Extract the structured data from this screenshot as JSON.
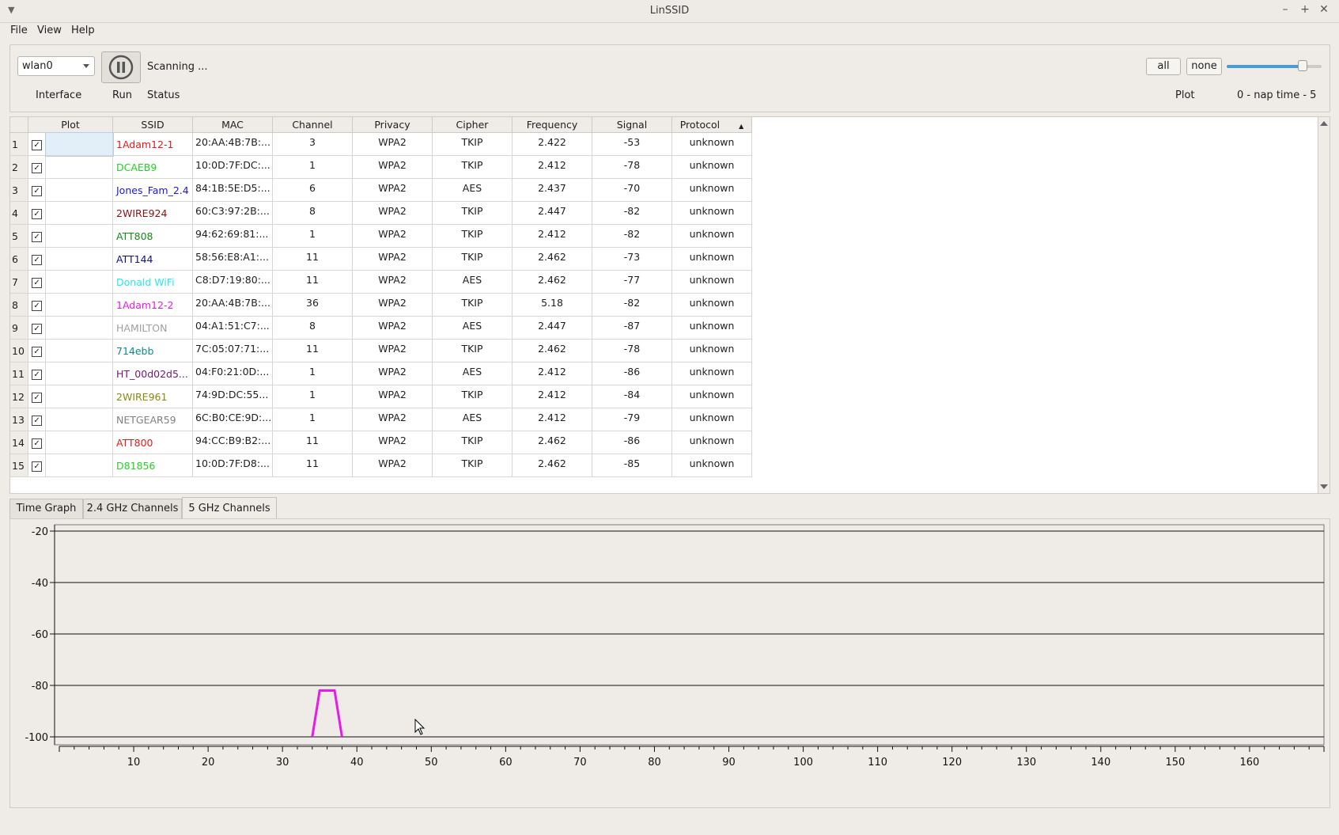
{
  "window": {
    "title": "LinSSID"
  },
  "menu": {
    "file": "File",
    "view": "View",
    "help": "Help"
  },
  "toolbar": {
    "interface_value": "wlan0",
    "status_text": "Scanning ...",
    "label_interface": "Interface",
    "label_run": "Run",
    "label_status": "Status",
    "btn_all": "all",
    "btn_none": "none",
    "label_plot": "Plot",
    "label_naptime": "0 - nap time - 5",
    "nap_time_level": 0.8
  },
  "table": {
    "headers": [
      "Plot",
      "SSID",
      "MAC",
      "Channel",
      "Privacy",
      "Cipher",
      "Frequency",
      "Signal",
      "Protocol"
    ],
    "rows": [
      {
        "n": "1",
        "ssid": "1Adam12-1",
        "color": "#e51a1a",
        "mac": "20:AA:4B:7B:...",
        "channel": "3",
        "privacy": "WPA2",
        "cipher": "TKIP",
        "freq": "2.422",
        "signal": "-53",
        "protocol": "unknown"
      },
      {
        "n": "2",
        "ssid": "DCAEB9",
        "color": "#22d322",
        "mac": "10:0D:7F:DC:...",
        "channel": "1",
        "privacy": "WPA2",
        "cipher": "TKIP",
        "freq": "2.412",
        "signal": "-78",
        "protocol": "unknown"
      },
      {
        "n": "3",
        "ssid": "Jones_Fam_2.4",
        "color": "#1a1adc",
        "mac": "84:1B:5E:D5:...",
        "channel": "6",
        "privacy": "WPA2",
        "cipher": "AES",
        "freq": "2.437",
        "signal": "-70",
        "protocol": "unknown"
      },
      {
        "n": "4",
        "ssid": "2WIRE924",
        "color": "#8b1010",
        "mac": "60:C3:97:2B:...",
        "channel": "8",
        "privacy": "WPA2",
        "cipher": "TKIP",
        "freq": "2.447",
        "signal": "-82",
        "protocol": "unknown"
      },
      {
        "n": "5",
        "ssid": "ATT808",
        "color": "#158c15",
        "mac": "94:62:69:81:...",
        "channel": "1",
        "privacy": "WPA2",
        "cipher": "TKIP",
        "freq": "2.412",
        "signal": "-82",
        "protocol": "unknown"
      },
      {
        "n": "6",
        "ssid": "ATT144",
        "color": "#12127a",
        "mac": "58:56:E8:A1:...",
        "channel": "11",
        "privacy": "WPA2",
        "cipher": "TKIP",
        "freq": "2.462",
        "signal": "-73",
        "protocol": "unknown"
      },
      {
        "n": "7",
        "ssid": "Donald WiFi",
        "color": "#28e8e8",
        "mac": "C8:D7:19:80:...",
        "channel": "11",
        "privacy": "WPA2",
        "cipher": "AES",
        "freq": "2.462",
        "signal": "-77",
        "protocol": "unknown"
      },
      {
        "n": "8",
        "ssid": "1Adam12-2",
        "color": "#e81ae8",
        "mac": "20:AA:4B:7B:...",
        "channel": "36",
        "privacy": "WPA2",
        "cipher": "TKIP",
        "freq": "5.18",
        "signal": "-82",
        "protocol": "unknown"
      },
      {
        "n": "9",
        "ssid": "HAMILTON",
        "color": "#a0a0a0",
        "mac": "04:A1:51:C7:...",
        "channel": "8",
        "privacy": "WPA2",
        "cipher": "AES",
        "freq": "2.447",
        "signal": "-87",
        "protocol": "unknown"
      },
      {
        "n": "10",
        "ssid": "714ebb",
        "color": "#0f8a8a",
        "mac": "7C:05:07:71:...",
        "channel": "11",
        "privacy": "WPA2",
        "cipher": "TKIP",
        "freq": "2.462",
        "signal": "-78",
        "protocol": "unknown"
      },
      {
        "n": "11",
        "ssid": "HT_00d02d5...",
        "color": "#7a127a",
        "mac": "04:F0:21:0D:...",
        "channel": "1",
        "privacy": "WPA2",
        "cipher": "AES",
        "freq": "2.412",
        "signal": "-86",
        "protocol": "unknown"
      },
      {
        "n": "12",
        "ssid": "2WIRE961",
        "color": "#8a8a10",
        "mac": "74:9D:DC:55...",
        "channel": "1",
        "privacy": "WPA2",
        "cipher": "TKIP",
        "freq": "2.412",
        "signal": "-84",
        "protocol": "unknown"
      },
      {
        "n": "13",
        "ssid": "NETGEAR59",
        "color": "#808080",
        "mac": "6C:B0:CE:9D:...",
        "channel": "1",
        "privacy": "WPA2",
        "cipher": "AES",
        "freq": "2.412",
        "signal": "-79",
        "protocol": "unknown"
      },
      {
        "n": "14",
        "ssid": "ATT800",
        "color": "#e51a1a",
        "mac": "94:CC:B9:B2:...",
        "channel": "11",
        "privacy": "WPA2",
        "cipher": "TKIP",
        "freq": "2.462",
        "signal": "-86",
        "protocol": "unknown"
      },
      {
        "n": "15",
        "ssid": "D81856",
        "color": "#22d322",
        "mac": "10:0D:7F:D8:...",
        "channel": "11",
        "privacy": "WPA2",
        "cipher": "TKIP",
        "freq": "2.462",
        "signal": "-85",
        "protocol": "unknown"
      }
    ]
  },
  "tabs": [
    "Time Graph",
    "2.4 GHz Channels",
    "5 GHz Channels"
  ],
  "active_tab": "5 GHz Channels",
  "chart_data": {
    "type": "line",
    "ylim": [
      -100,
      -20
    ],
    "yticks": [
      -20,
      -40,
      -60,
      -80,
      -100
    ],
    "xlim": [
      0,
      170
    ],
    "xticks": [
      10,
      20,
      30,
      40,
      50,
      60,
      70,
      80,
      90,
      100,
      110,
      120,
      130,
      140,
      150,
      160
    ],
    "grid": true,
    "series": [
      {
        "color": "#e81ae8",
        "x": [
          34,
          35,
          37,
          38
        ],
        "y": [
          -100,
          -82,
          -82,
          -100
        ]
      }
    ]
  }
}
